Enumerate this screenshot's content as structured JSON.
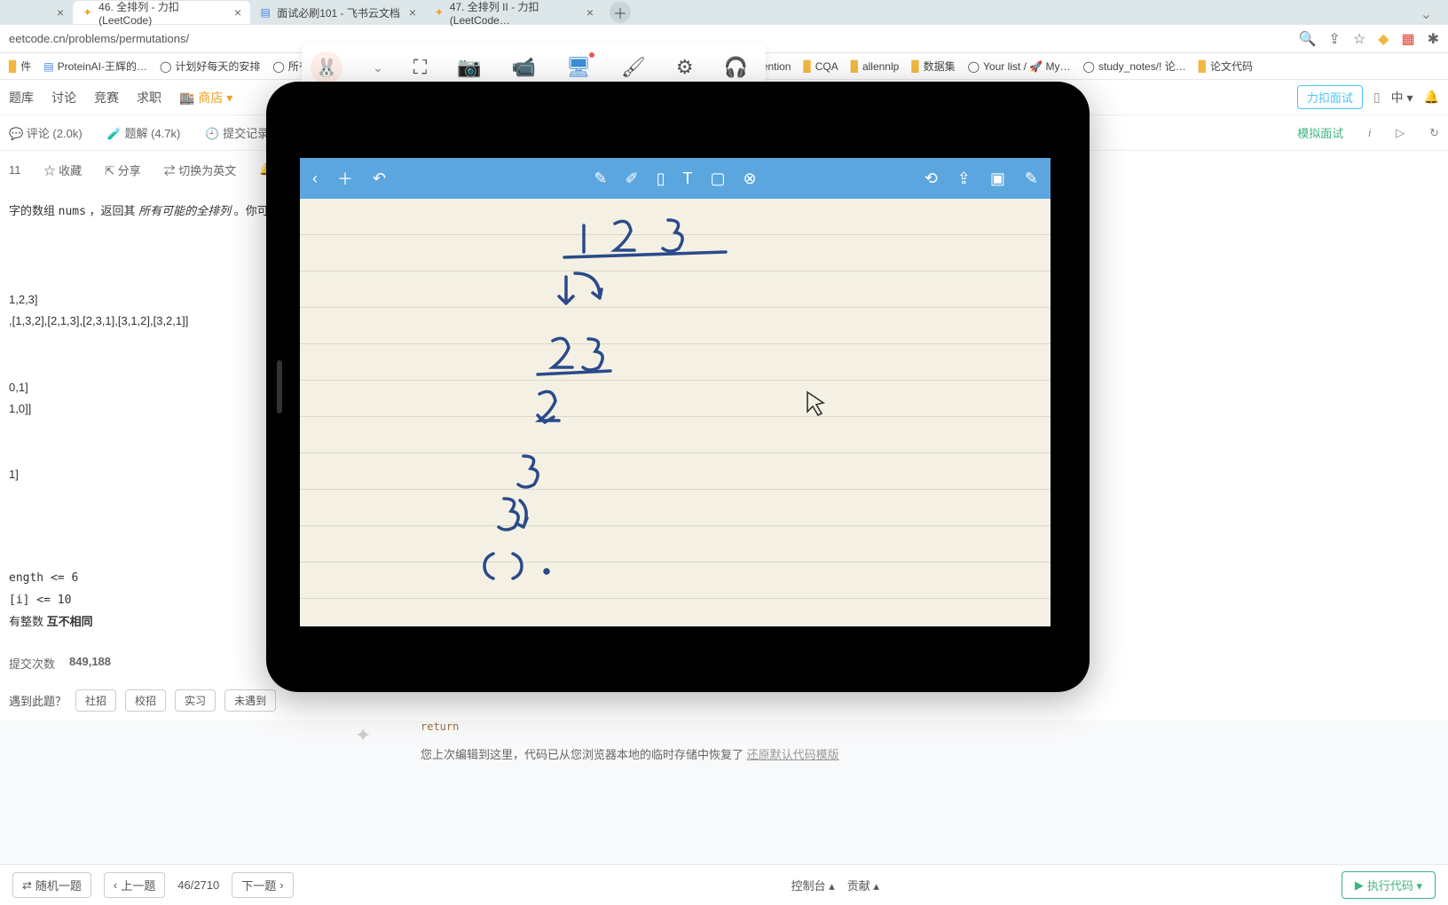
{
  "tabs": [
    {
      "title": "",
      "fav": "○"
    },
    {
      "title": "46. 全排列 - 力扣 (LeetCode)",
      "fav": "✦"
    },
    {
      "title": "面试必刷101 - 飞书云文档",
      "fav": "📄"
    },
    {
      "title": "47. 全排列 II - 力扣 (LeetCode…",
      "fav": "✦"
    }
  ],
  "url": "eetcode.cn/problems/permutations/",
  "bookmarks": [
    {
      "label": "件",
      "kind": "folder"
    },
    {
      "label": "ProteinAI-王辉的…",
      "kind": "doc"
    },
    {
      "label": "计划好每天的安排",
      "kind": "gh"
    },
    {
      "label": "所有代码以及",
      "kind": "gh"
    },
    {
      "label": "Attention",
      "kind": "folder"
    },
    {
      "label": "CQA",
      "kind": "folder"
    },
    {
      "label": "allennlp",
      "kind": "folder"
    },
    {
      "label": "数据集",
      "kind": "folder"
    },
    {
      "label": "Your list / 🚀 My…",
      "kind": "gh"
    },
    {
      "label": "study_notes/! 论…",
      "kind": "gh"
    },
    {
      "label": "论文代码",
      "kind": "folder"
    }
  ],
  "lcnav": {
    "items": [
      "题库",
      "讨论",
      "竞赛",
      "求职"
    ],
    "store": "🏬 商店 ▾",
    "interview_btn": "力扣面试",
    "lang": "中 ▾"
  },
  "subnav": {
    "comments": "评论 (2.0k)",
    "solutions": "题解 (4.7k)",
    "history": "提交记录",
    "mock": "模拟面试"
  },
  "actions": {
    "num": "11",
    "fav": "收藏",
    "share": "分享",
    "toggle": "切换为英文",
    "notify": ""
  },
  "problem": {
    "desc_prefix": "字的数组 ",
    "desc_code": "nums",
    "desc_mid": " ，返回其 ",
    "desc_em": "所有可能的全排列",
    "desc_suffix": " 。你可以",
    "ex1_in": "1,2,3]",
    "ex1_out": ",[1,3,2],[2,1,3],[2,3,1],[3,1,2],[3,2,1]]",
    "ex2_in": "0,1]",
    "ex2_out": "1,0]]",
    "ex3_in": "1]",
    "c1": "ength <= 6",
    "c2": "[i] <= 10",
    "c3_prefix": "有整数 ",
    "c3_bold": "互不相同"
  },
  "stats": {
    "label": "提交次数",
    "count": "849,188"
  },
  "encounter": {
    "q": "遇到此题？",
    "tags": [
      "社招",
      "校招",
      "实习",
      "未遇到"
    ]
  },
  "editor": {
    "tip_prefix": "您上次编辑到这里，代码已从您浏览器本地的临时存储中恢复了 ",
    "tip_link": "还原默认代码模版",
    "code_line": "return"
  },
  "pager": {
    "random": "随机一题",
    "prev": "上一题",
    "pos": "46/2710",
    "next": "下一题",
    "console": "控制台 ▴",
    "contrib": "贡献 ▴",
    "run": "执行代码 ▾"
  },
  "tablet_icons": {
    "back": "‹",
    "add": "＋",
    "undo": "↶",
    "pen1": "✎",
    "pen2": "✐",
    "phone": "▯",
    "text": "T",
    "rect": "▢",
    "erase": "⊗",
    "rotate": "⟲",
    "share": "⇪",
    "copy": "▣",
    "more": "✎"
  }
}
